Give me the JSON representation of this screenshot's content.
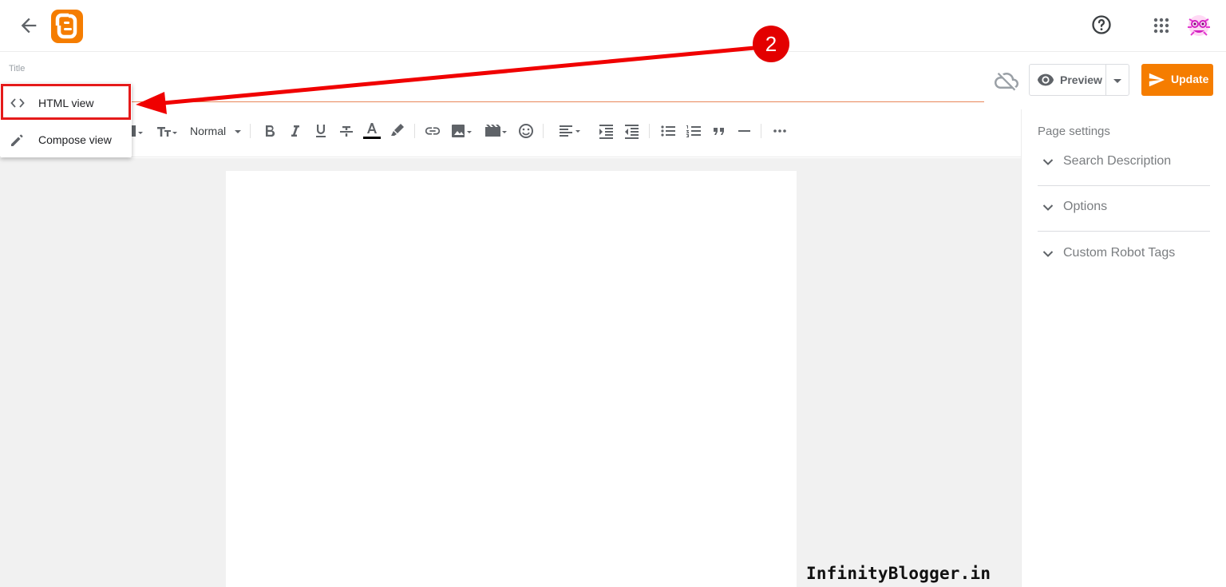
{
  "header": {
    "back_icon": "arrow-left-icon",
    "logo_icon": "blogger-logo",
    "help_icon": "help-circle-icon",
    "apps_icon": "apps-grid-icon",
    "avatar_icon": "user-avatar"
  },
  "post": {
    "title_label": "Title",
    "title_value": ""
  },
  "actions": {
    "cloud_icon": "cloud-off-icon",
    "preview_label": "Preview",
    "update_label": "Update"
  },
  "mode_menu": {
    "items": [
      {
        "label": "HTML view",
        "icon": "code-icon",
        "highlighted": true
      },
      {
        "label": "Compose view",
        "icon": "pencil-icon",
        "highlighted": false
      }
    ]
  },
  "toolbar": {
    "paragraph_style": "Normal"
  },
  "settings": {
    "title": "Page settings",
    "sections": [
      {
        "label": "Search Description"
      },
      {
        "label": "Options"
      },
      {
        "label": "Custom Robot Tags"
      }
    ]
  },
  "annotation": {
    "step_number": "2"
  },
  "watermark": "InfinityBlogger.in",
  "colors": {
    "brand_orange": "#f57d00",
    "annotation_red": "#e30000",
    "title_underline": "#e8875a"
  }
}
